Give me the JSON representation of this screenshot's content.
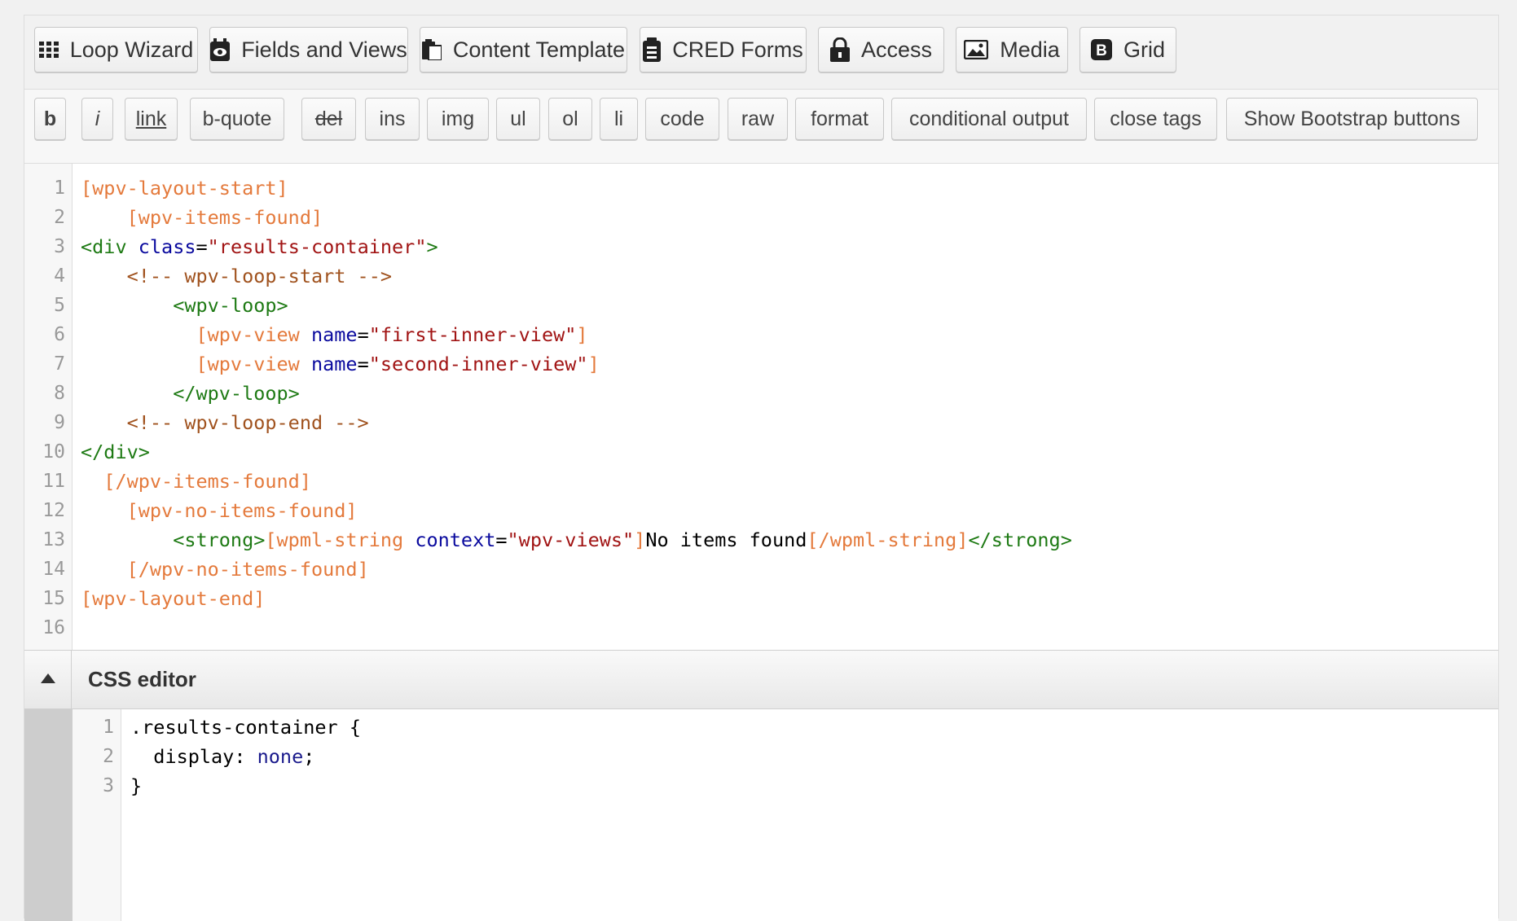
{
  "toolbar": {
    "loop_wizard": "Loop Wizard",
    "fields_and_views": "Fields and Views",
    "content_template": "Content Template",
    "cred_forms": "CRED Forms",
    "access": "Access",
    "media": "Media",
    "grid": "Grid"
  },
  "quicktags": {
    "b": "b",
    "i": "i",
    "link": "link",
    "b_quote": "b-quote",
    "del": "del",
    "ins": "ins",
    "img": "img",
    "ul": "ul",
    "ol": "ol",
    "li": "li",
    "code": "code",
    "raw": "raw",
    "format": "format",
    "conditional_output": "conditional output",
    "close_tags": "close tags",
    "show_bootstrap": "Show Bootstrap buttons"
  },
  "editor": {
    "line_numbers": [
      "1",
      "2",
      "3",
      "4",
      "5",
      "6",
      "7",
      "8",
      "9",
      "10",
      "11",
      "12",
      "13",
      "14",
      "15",
      "16"
    ],
    "lines": [
      "[wpv-layout-start]",
      "    [wpv-items-found]",
      "<div class=\"results-container\">",
      "    <!-- wpv-loop-start -->",
      "        <wpv-loop>",
      "          [wpv-view name=\"first-inner-view\"]",
      "          [wpv-view name=\"second-inner-view\"]",
      "        </wpv-loop>",
      "    <!-- wpv-loop-end -->",
      "</div>",
      "  [/wpv-items-found]",
      "    [wpv-no-items-found]",
      "        <strong>[wpml-string context=\"wpv-views\"]No items found[/wpml-string]</strong>",
      "    [/wpv-no-items-found]",
      "[wpv-layout-end]",
      ""
    ]
  },
  "css_editor": {
    "title": "CSS editor",
    "line_numbers": [
      "1",
      "2",
      "3"
    ],
    "lines": [
      ".results-container {",
      "  display: none;",
      "}"
    ]
  },
  "icons": {
    "loop_wizard": "grid-dots-icon",
    "fields_and_views": "eye-badge-icon",
    "content_template": "clipboard-icon",
    "cred_forms": "form-stack-icon",
    "access": "padlock-icon",
    "media": "image-icon",
    "grid": "bootstrap-b-icon",
    "css_toggle": "triangle-up-icon"
  },
  "colors": {
    "shortcode": "#e47a3c",
    "tag": "#1e7a14",
    "attribute": "#0a0a9e",
    "string": "#a11414",
    "comment": "#a0521e"
  }
}
